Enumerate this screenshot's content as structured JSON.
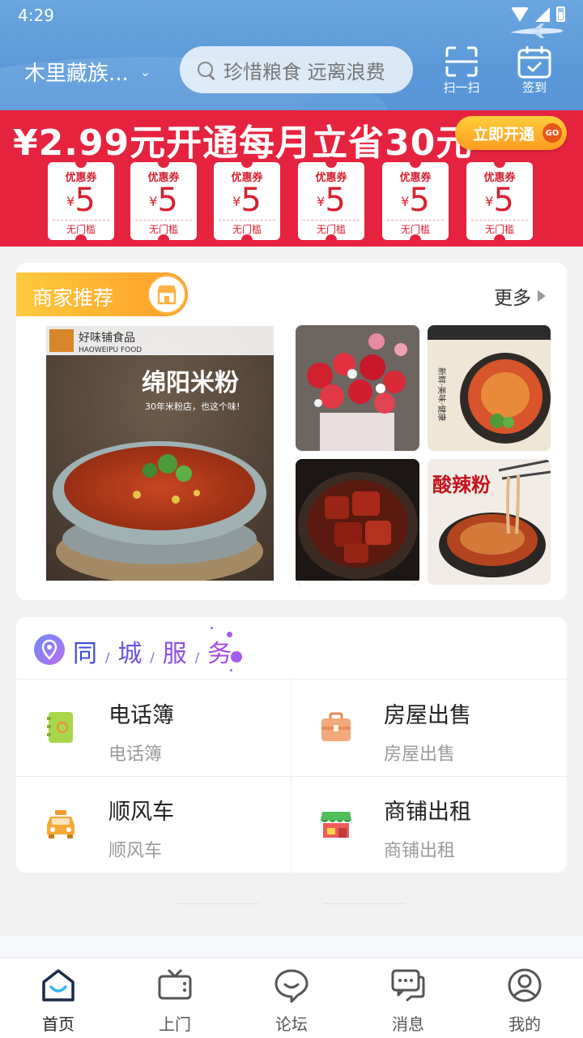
{
  "status_bar": {
    "time": "4:29"
  },
  "header": {
    "location": "木里藏族...",
    "search_placeholder": "珍惜粮食 远离浪费",
    "scan_label": "扫一扫",
    "checkin_label": "签到"
  },
  "promo": {
    "title": "¥2.99元开通每月立省30元",
    "button_label": "立即开通",
    "button_badge": "GO",
    "coupons": [
      {
        "title": "优惠券",
        "currency": "¥",
        "value": "5",
        "subtitle": "无门槛"
      },
      {
        "title": "优惠券",
        "currency": "¥",
        "value": "5",
        "subtitle": "无门槛"
      },
      {
        "title": "优惠券",
        "currency": "¥",
        "value": "5",
        "subtitle": "无门槛"
      },
      {
        "title": "优惠券",
        "currency": "¥",
        "value": "5",
        "subtitle": "无门槛"
      },
      {
        "title": "优惠券",
        "currency": "¥",
        "value": "5",
        "subtitle": "无门槛"
      },
      {
        "title": "优惠券",
        "currency": "¥",
        "value": "5",
        "subtitle": "无门槛"
      }
    ]
  },
  "merchants": {
    "tag_label": "商家推荐",
    "more_label": "更多",
    "featured": {
      "brand_cn": "好味铺食品",
      "brand_en": "HAOWEIPU FOOD",
      "dish_name": "绵阳米粉",
      "slogan": "30年米粉店，也这个味!"
    },
    "tiles": [
      {
        "icon": "flower-bouquet-image"
      },
      {
        "icon": "cold-noodles-image",
        "text": "新鲜·美味·健康"
      },
      {
        "icon": "braised-pork-image"
      },
      {
        "icon": "hot-sour-noodles-image",
        "text": "酸辣粉"
      }
    ]
  },
  "services": {
    "title_chars": [
      "同",
      "城",
      "服",
      "务"
    ],
    "items": [
      {
        "name": "电话簿",
        "desc": "电话簿",
        "icon": "phonebook-icon"
      },
      {
        "name": "房屋出售",
        "desc": "房屋出售",
        "icon": "briefcase-icon"
      },
      {
        "name": "顺风车",
        "desc": "顺风车",
        "icon": "car-icon"
      },
      {
        "name": "商铺出租",
        "desc": "商铺出租",
        "icon": "shop-icon"
      }
    ]
  },
  "bottom_nav": {
    "items": [
      {
        "label": "首页",
        "icon": "home-icon"
      },
      {
        "label": "上门",
        "icon": "tv-icon"
      },
      {
        "label": "论坛",
        "icon": "chat-bubble-icon"
      },
      {
        "label": "消息",
        "icon": "message-icon"
      },
      {
        "label": "我的",
        "icon": "user-icon"
      }
    ]
  },
  "colors": {
    "header_blue": "#5d9ad9",
    "promo_red": "#e6233f",
    "merchant_orange": "#ff9d2a",
    "service_purple": "#6a55df",
    "nav_active": "#1a2a4a"
  }
}
